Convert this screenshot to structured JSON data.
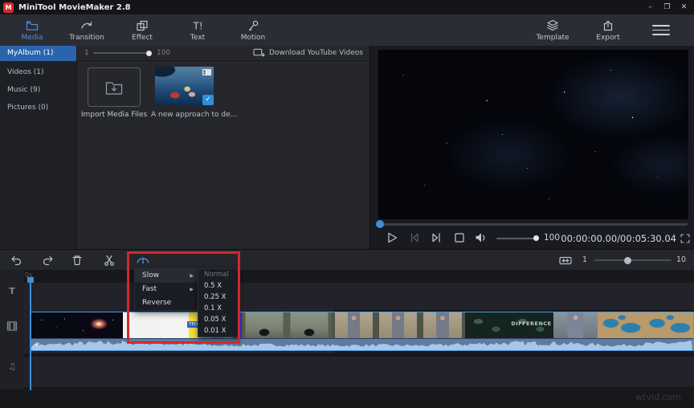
{
  "window": {
    "title": "MiniTool MovieMaker 2.8",
    "logo_letter": "M",
    "controls": {
      "minimize": "–",
      "maximize": "❐",
      "close": "✕"
    }
  },
  "toolbar": {
    "tabs": [
      {
        "label": "Media",
        "active": true
      },
      {
        "label": "Transition"
      },
      {
        "label": "Effect"
      },
      {
        "label": "Text"
      },
      {
        "label": "Motion"
      }
    ],
    "right_tabs": [
      {
        "label": "Template"
      },
      {
        "label": "Export"
      }
    ],
    "text_tab_glyph": "T!"
  },
  "sidebar": {
    "items": [
      {
        "label": "MyAlbum (1)",
        "selected": true
      },
      {
        "label": "Videos (1)"
      },
      {
        "label": "Music (9)"
      },
      {
        "label": "Pictures (0)"
      }
    ]
  },
  "media_panel": {
    "zoom_min": "1",
    "zoom_max": "100",
    "download_link": "Download YouTube Videos",
    "import_label": "Import Media Files",
    "clip_caption": "A new approach to de...",
    "check_glyph": "✓"
  },
  "preview": {
    "volume": "100",
    "timecode": "00:00:00.00/00:05:30.04"
  },
  "timeline_toolbar": {
    "zoom_min": "1",
    "zoom_max": "10"
  },
  "timeline": {
    "ruler_start": "0s",
    "text_track_glyph": "T",
    "music_track_glyph": "♫"
  },
  "speed_menu": {
    "items": [
      {
        "label": "Slow",
        "has_submenu": true,
        "highlighted": true
      },
      {
        "label": "Fast",
        "has_submenu": true
      },
      {
        "label": "Reverse"
      }
    ],
    "submenu_arrow": "▶",
    "submenu": [
      {
        "label": "Normal",
        "disabled": true
      },
      {
        "label": "0.5 X"
      },
      {
        "label": "0.25 X"
      },
      {
        "label": "0.1 X"
      },
      {
        "label": "0.05 X"
      },
      {
        "label": "0.01 X"
      }
    ]
  },
  "clip_labels": {
    "ted": "TEDFellows",
    "difference": "DIFFERENCE"
  },
  "watermark": "wtvid.com",
  "colors": {
    "accent": "#4a90d9",
    "selected_blue": "#2a64ad",
    "annotation_red": "#d4282a",
    "clip_border": "#4a9be0"
  }
}
